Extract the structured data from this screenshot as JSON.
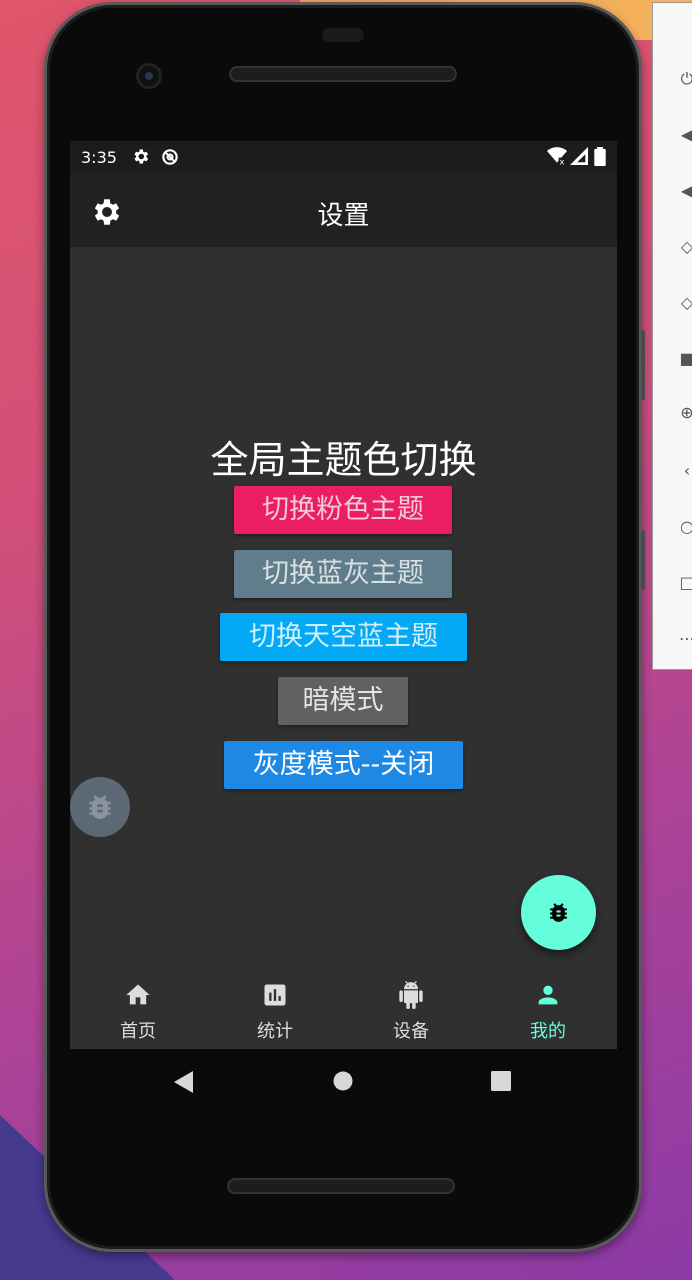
{
  "colors": {
    "accent": "#64ffda",
    "pink": "#e91e63",
    "blue_grey": "#607d8b",
    "sky_blue": "#03a9f4",
    "dark": "#616161",
    "grey_mode": "#1e88e5"
  },
  "status_bar": {
    "time": "3:35"
  },
  "app_bar": {
    "title": "设置"
  },
  "main": {
    "section_title": "全局主题色切换",
    "buttons": [
      {
        "label": "切换粉色主题",
        "color": "#e91e63"
      },
      {
        "label": "切换蓝灰主题",
        "color": "#607d8b"
      },
      {
        "label": "切换天空蓝主题",
        "color": "#03a9f4"
      },
      {
        "label": "暗模式",
        "color": "#616161"
      },
      {
        "label": "灰度模式--关闭",
        "color": "#1e88e5"
      }
    ]
  },
  "bottom_nav": {
    "items": [
      {
        "label": "首页",
        "icon": "home-icon"
      },
      {
        "label": "统计",
        "icon": "bar-chart-icon"
      },
      {
        "label": "设备",
        "icon": "android-icon"
      },
      {
        "label": "我的",
        "icon": "person-icon",
        "active": true
      }
    ]
  }
}
